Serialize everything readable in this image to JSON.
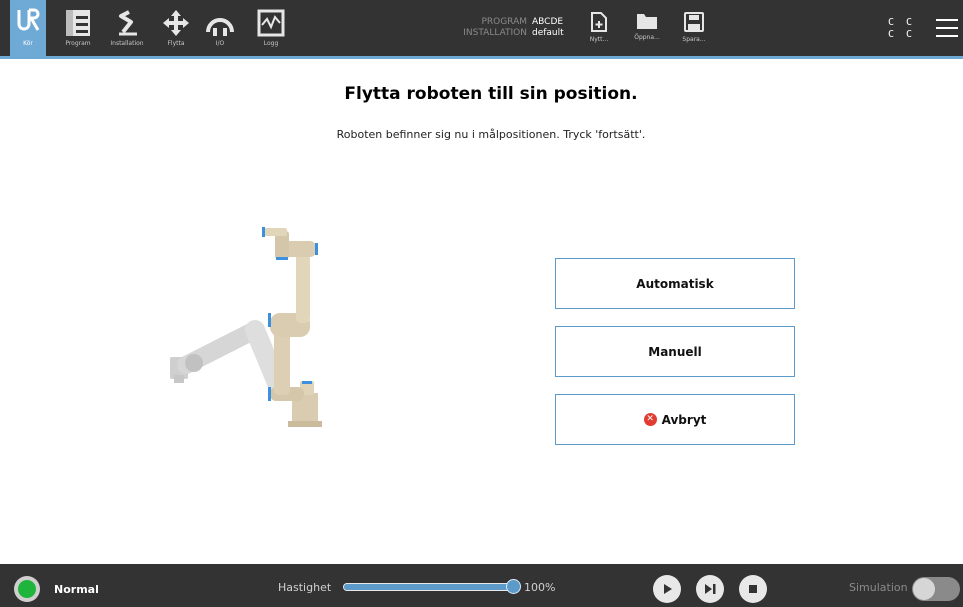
{
  "nav": [
    {
      "label": "Kör",
      "icon": "ur-logo-icon",
      "active": true
    },
    {
      "label": "Program",
      "icon": "program-icon"
    },
    {
      "label": "Installation",
      "icon": "installation-icon"
    },
    {
      "label": "Flytta",
      "icon": "move-icon"
    },
    {
      "label": "I/O",
      "icon": "io-icon"
    },
    {
      "label": "Logg",
      "icon": "log-icon"
    }
  ],
  "program_info": {
    "program_key": "PROGRAM",
    "program_value": "ABCDE",
    "installation_key": "INSTALLATION",
    "installation_value": "default"
  },
  "file_buttons": [
    {
      "label": "Nytt...",
      "icon": "new-file-icon"
    },
    {
      "label": "Öppna...",
      "icon": "open-folder-icon"
    },
    {
      "label": "Spara...",
      "icon": "save-icon"
    }
  ],
  "cc": {
    "row1": "C C",
    "row2": "C C"
  },
  "main": {
    "title": "Flytta roboten till sin position.",
    "subtitle": "Roboten befinner sig nu i målpositionen. Tryck 'fortsätt'.",
    "buttons": {
      "auto": "Automatisk",
      "manual": "Manuell",
      "cancel": "Avbryt"
    }
  },
  "footer": {
    "status": "Normal",
    "speed_label": "Hastighet",
    "speed_value": "100%",
    "speed_fraction": 1.0,
    "simulation_label": "Simulation",
    "simulation_on": false
  },
  "colors": {
    "accent": "#6fa9d6",
    "topbar": "#333333",
    "status_ok": "#1fb53c",
    "cancel": "#e03c31"
  }
}
